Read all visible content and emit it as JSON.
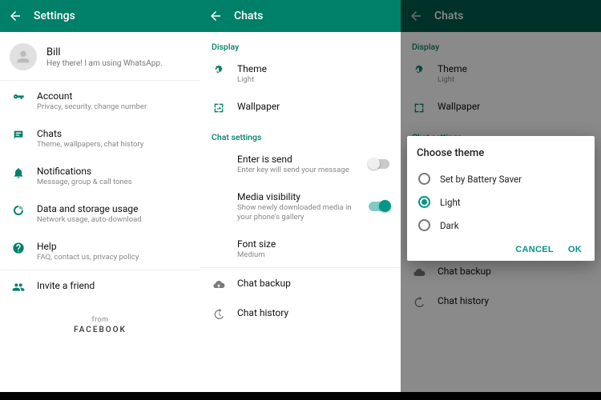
{
  "accent": "#008069",
  "panel1": {
    "title": "Settings",
    "profile": {
      "name": "Bill",
      "status": "Hey there! I am using WhatsApp."
    },
    "items": [
      {
        "title": "Account",
        "sub": "Privacy, security, change number"
      },
      {
        "title": "Chats",
        "sub": "Theme, wallpapers, chat history"
      },
      {
        "title": "Notifications",
        "sub": "Message, group & call tones"
      },
      {
        "title": "Data and storage usage",
        "sub": "Network usage, auto-download"
      },
      {
        "title": "Help",
        "sub": "FAQ, contact us, privacy policy"
      },
      {
        "title": "Invite a friend",
        "sub": ""
      }
    ],
    "from": "from",
    "brand": "FACEBOOK"
  },
  "panel2": {
    "title": "Chats",
    "sections": {
      "display": "Display",
      "chat_settings": "Chat settings"
    },
    "theme": {
      "title": "Theme",
      "value": "Light"
    },
    "wallpaper": {
      "title": "Wallpaper"
    },
    "enter": {
      "title": "Enter is send",
      "sub": "Enter key will send your message",
      "on": false
    },
    "media": {
      "title": "Media visibility",
      "sub": "Show newly downloaded media in your phone's gallery",
      "on": true
    },
    "font": {
      "title": "Font size",
      "value": "Medium"
    },
    "backup": {
      "title": "Chat backup"
    },
    "history": {
      "title": "Chat history"
    }
  },
  "panel3": {
    "title": "Chats",
    "sections": {
      "display": "Display",
      "chat_settings": "Chat settings"
    },
    "theme": {
      "title": "Theme",
      "value": "Light"
    },
    "wallpaper": {
      "title": "Wallpaper"
    },
    "backup": {
      "title": "Chat backup"
    },
    "history": {
      "title": "Chat history"
    },
    "dialog": {
      "title": "Choose theme",
      "options": [
        "Set by Battery Saver",
        "Light",
        "Dark"
      ],
      "selected": 1,
      "cancel": "CANCEL",
      "ok": "OK"
    }
  }
}
